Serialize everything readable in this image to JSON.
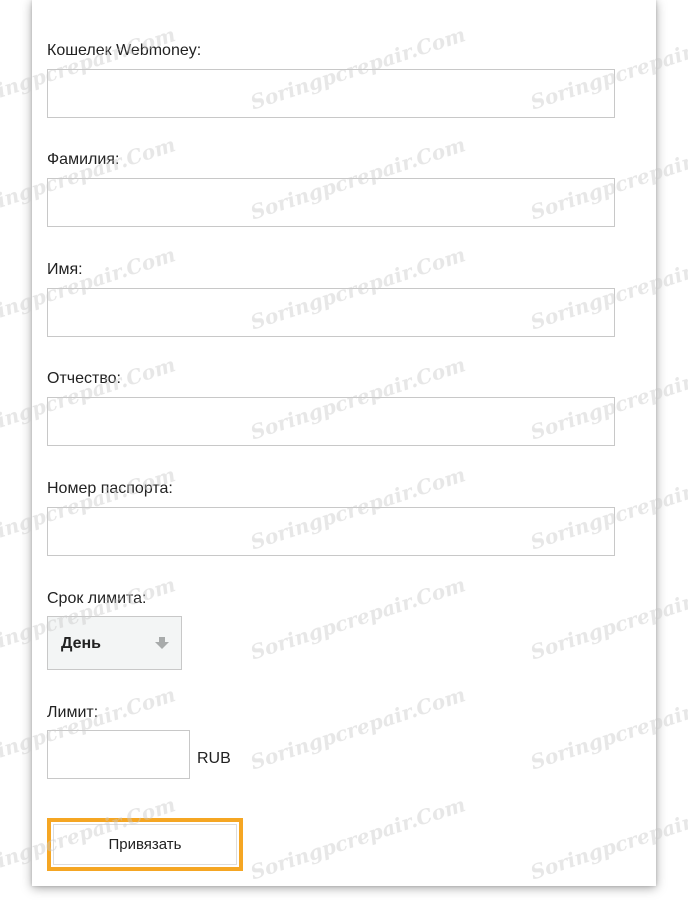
{
  "form": {
    "fields": [
      {
        "label": "Кошелек Webmoney:",
        "value": ""
      },
      {
        "label": "Фамилия:",
        "value": ""
      },
      {
        "label": "Имя:",
        "value": ""
      },
      {
        "label": "Отчество:",
        "value": ""
      },
      {
        "label": "Номер паспорта:",
        "value": ""
      }
    ],
    "limit_period": {
      "label": "Срок лимита:",
      "selected": "День",
      "arrow_icon": "down-arrow-icon"
    },
    "limit": {
      "label": "Лимит:",
      "value": "",
      "currency": "RUB"
    },
    "submit_label": "Привязать"
  },
  "watermark_text": "Soringpcrepair.Com",
  "colors": {
    "accent_border": "#f5a623",
    "input_border": "#c8c8c8",
    "select_bg": "#f3f5f5"
  }
}
